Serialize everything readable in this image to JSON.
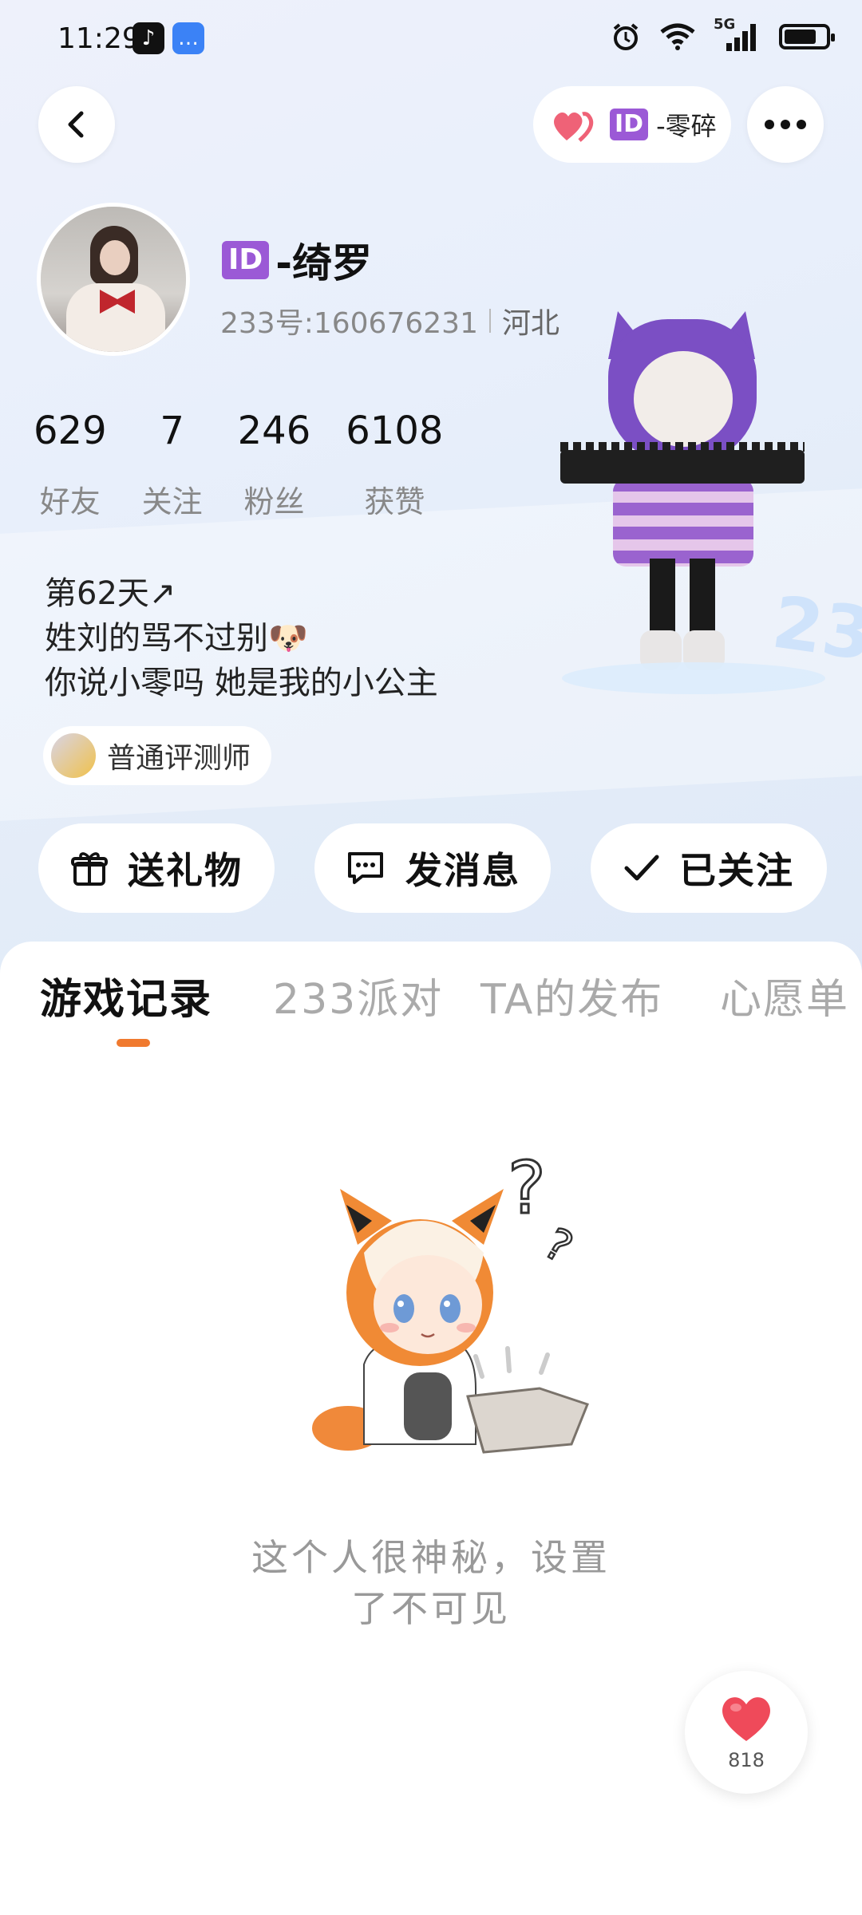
{
  "status_bar": {
    "time": "11:29",
    "network": "5G"
  },
  "header": {
    "couple_name": "-零碎",
    "id_badge": "ID"
  },
  "profile": {
    "id_badge": "ID",
    "name": "-绮罗",
    "uid": "233号:160676231",
    "region": "河北"
  },
  "stats": [
    {
      "value": "629",
      "label": "好友"
    },
    {
      "value": "7",
      "label": "关注"
    },
    {
      "value": "246",
      "label": "粉丝"
    },
    {
      "value": "6108",
      "label": "获赞"
    }
  ],
  "bio": {
    "line1": "第62天↗",
    "line2": "姓刘的骂不过别🐶",
    "line3": "你说小零吗 她是我的小公主"
  },
  "badge": {
    "label": "普通评测师"
  },
  "actions": {
    "gift": "送礼物",
    "message": "发消息",
    "follow": "已关注"
  },
  "tabs": [
    {
      "label": "游戏记录"
    },
    {
      "label": "233派对"
    },
    {
      "label": "TA的发布"
    },
    {
      "label": "心愿单"
    }
  ],
  "empty_state": {
    "text": "这个人很神秘，设置了不可见"
  },
  "like_fab": {
    "count": "818"
  },
  "colors": {
    "accent": "#f07a2f",
    "id_badge": "#9b59d6",
    "heart": "#ef4a5a"
  }
}
